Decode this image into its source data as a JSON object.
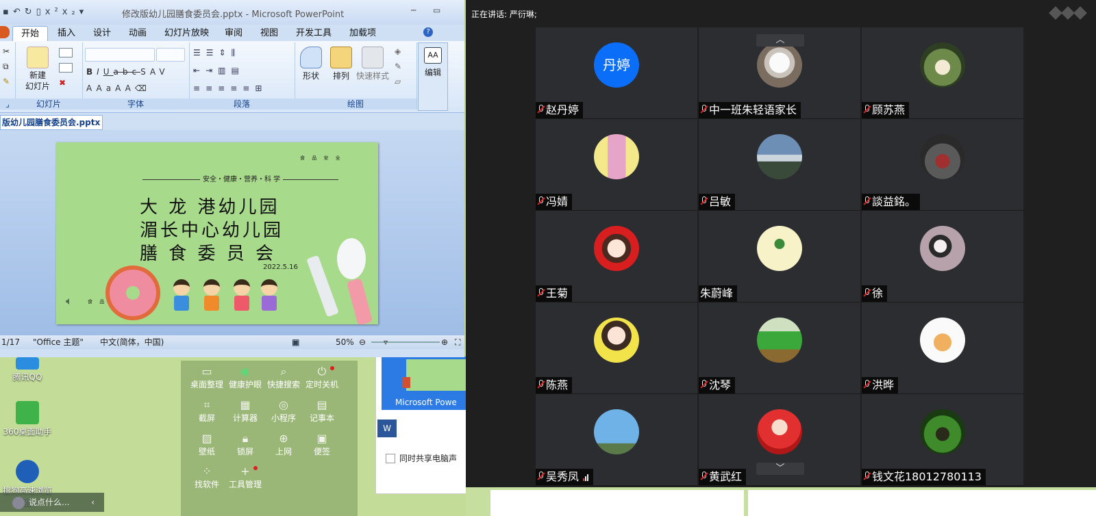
{
  "powerpoint": {
    "window_title": "修改版幼儿园膳食委员会.pptx - Microsoft PowerPoint",
    "tabs": [
      "开始",
      "插入",
      "设计",
      "动画",
      "幻灯片放映",
      "审阅",
      "视图",
      "开发工具",
      "加载项"
    ],
    "ribbon": {
      "slides_group": "幻灯片",
      "new_slide": "新建\n幻灯片",
      "font_group": "字体",
      "paragraph_group": "段落",
      "drawing_group": "绘图",
      "shapes": "形状",
      "arrange": "排列",
      "quick_styles": "快速样式",
      "edit": "编辑"
    },
    "document_tab": "版幼儿园膳食委员会.pptx",
    "slide": {
      "tagline": "安全・健康・营养・科 学",
      "line1": "大 龙 港幼儿园",
      "line2": "湄长中心幼儿园",
      "line3": "膳 食 委 员 会",
      "date": "2022.5.16",
      "tag_top": "食 品 安 全",
      "tag_bottom": "食 品 安 全"
    },
    "status": {
      "page": "1/17",
      "theme": "\"Office 主题\"",
      "language": "中文(简体，中国)",
      "zoom": "50%"
    }
  },
  "desktop": {
    "icons": [
      "腾讯QQ",
      "360桌面助手",
      "搜狗高速浏览器"
    ],
    "tools": [
      "桌面整理",
      "健康护眼",
      "快捷搜索",
      "定时关机",
      "截屏",
      "计算器",
      "小程序",
      "记事本",
      "壁纸",
      "锁屏",
      "上网",
      "便签",
      "找软件",
      "工具管理"
    ],
    "speak_placeholder": "说点什么...",
    "taskbar_preview_label": "Microsoft Powe",
    "share_sound_label": "同时共享电脑声"
  },
  "meeting": {
    "speaking": "正在讲话: 严衍琳;",
    "participants": [
      {
        "name": "赵丹婷",
        "avatar_text": "丹婷",
        "muted": true
      },
      {
        "name": "中一班朱轻语家长",
        "muted": true
      },
      {
        "name": "顾苏燕",
        "muted": true
      },
      {
        "name": "冯婧",
        "muted": true
      },
      {
        "name": "吕敏",
        "muted": true
      },
      {
        "name": "談益銘。",
        "muted": true
      },
      {
        "name": "王菊",
        "muted": true
      },
      {
        "name": "朱蔚峰",
        "muted": false
      },
      {
        "name": "徐",
        "muted": true
      },
      {
        "name": "陈燕",
        "muted": true
      },
      {
        "name": "沈琴",
        "muted": true
      },
      {
        "name": "洪晔",
        "muted": true
      },
      {
        "name": "吴秀凤",
        "muted": true
      },
      {
        "name": "黄武红",
        "muted": true
      },
      {
        "name": "钱文花18012780113",
        "muted": true
      }
    ]
  },
  "colors": {
    "meeting_bg": "#1f1f20",
    "tile_bg": "#2c2d30",
    "avatar_blue": "#0b6ef8",
    "slide_green": "#a8da8c",
    "mic_red": "#e02020"
  }
}
